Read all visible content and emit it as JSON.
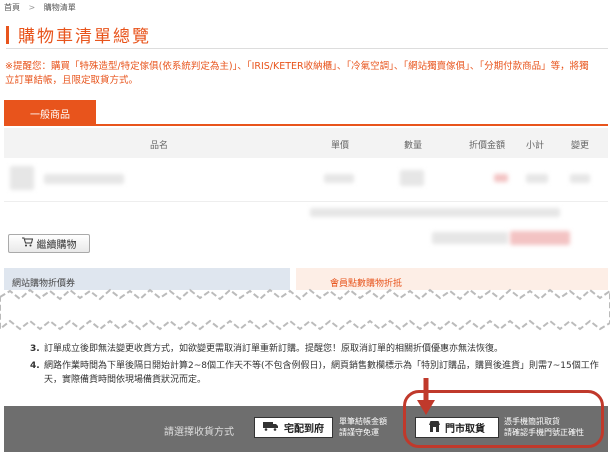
{
  "breadcrumb": {
    "home": "首頁",
    "separator": ">",
    "current": "購物清單"
  },
  "page": {
    "title": "購物車清單總覽"
  },
  "notice": {
    "text": "※提醒您：購買「特殊造型/特定傢俱(依系統判定為主)」、「IRIS/KETER收納櫃」、「冷氣空調」、「網站獨賣傢俱」、「分期付款商品」等，將獨立訂單結帳，且限定取貨方式。"
  },
  "tabs": [
    {
      "label": "一般商品",
      "active": true
    }
  ],
  "table": {
    "columns": [
      "品名",
      "單價",
      "數量",
      "折價金額",
      "小計",
      "變更"
    ]
  },
  "actions": {
    "continue_shopping": "繼續購物"
  },
  "promos": {
    "site_discount": "網站購物折價券",
    "member_points": "會員點數購物折抵"
  },
  "notes": [
    {
      "num": "3.",
      "text": "訂單成立後即無法變更收貨方式，如欲變更需取消訂單重新訂購。提醒您！原取消訂單的相關折價優惠亦無法恢復。"
    },
    {
      "num": "4.",
      "text": "網路作業時間為下單後隔日開始計算2~8個工作天不等(不包含例假日)，網頁銷售數欄標示為「特別訂購品，購買後進貨」則需7~15個工作天，實際備貨時間依現場備貨狀況而定。"
    }
  ],
  "checkout": {
    "prompt": "請選擇收貨方式",
    "home_delivery": {
      "label": "宅配到府",
      "note_line1": "單筆結帳金額",
      "note_line2": "請謹守免運"
    },
    "store_pickup": {
      "label": "門市取貨",
      "note_line1": "憑手機簡訊取貨",
      "note_line2": "請確認手機門號正確性"
    }
  },
  "colors": {
    "accent": "#e8541c",
    "bar": "#6e6e6e",
    "highlight": "#c0392b"
  },
  "icons": {
    "cart": "shopping-cart-icon",
    "truck": "truck-icon",
    "store": "store-icon"
  }
}
